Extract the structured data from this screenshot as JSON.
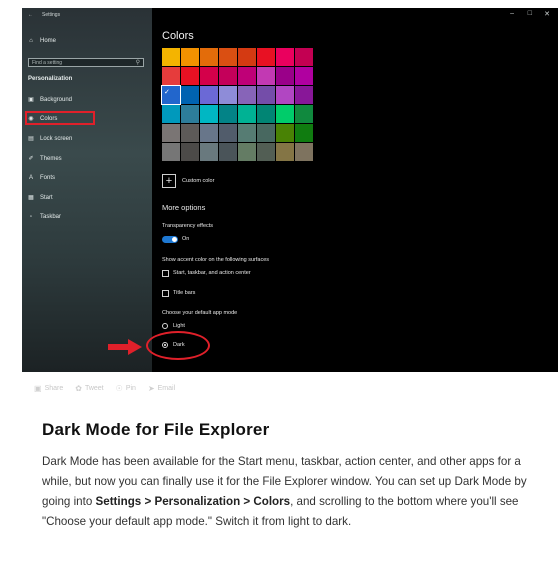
{
  "window": {
    "title": "Settings",
    "controls": [
      "–",
      "□",
      "✕"
    ]
  },
  "sidebar": {
    "home": "Home",
    "search_placeholder": "Find a setting",
    "section_title": "Personalization",
    "items": [
      {
        "label": "Background",
        "icon": "image-icon"
      },
      {
        "label": "Colors",
        "icon": "palette-icon"
      },
      {
        "label": "Lock screen",
        "icon": "lock-screen-icon"
      },
      {
        "label": "Themes",
        "icon": "brush-icon"
      },
      {
        "label": "Fonts",
        "icon": "font-icon"
      },
      {
        "label": "Start",
        "icon": "start-icon"
      },
      {
        "label": "Taskbar",
        "icon": "taskbar-icon"
      }
    ]
  },
  "main": {
    "title": "Colors",
    "swatches": [
      [
        "#f4b400",
        "#f39200",
        "#e36c0a",
        "#da4f12",
        "#d43a12",
        "#e81123",
        "#ea005e",
        "#c30052"
      ],
      [
        "#e63c3c",
        "#e81123",
        "#d4004a",
        "#c4005a",
        "#bf0077",
        "#c239b3",
        "#9a0089",
        "#b000a0"
      ],
      [
        "#2266cc",
        "#0063b1",
        "#6b69d6",
        "#8e8cd8",
        "#8764b8",
        "#744da9",
        "#b146c2",
        "#881798"
      ],
      [
        "#0099bc",
        "#2d7d9a",
        "#00b7c3",
        "#038387",
        "#00b294",
        "#018574",
        "#00cc6a",
        "#10893e"
      ],
      [
        "#7a7574",
        "#5d5a58",
        "#68768a",
        "#515c6b",
        "#567c73",
        "#486860",
        "#498205",
        "#107c10"
      ],
      [
        "#767676",
        "#4c4a48",
        "#69797e",
        "#4a5459",
        "#647c64",
        "#525e54",
        "#847545",
        "#7e735f"
      ]
    ],
    "selected_swatch": "2-0",
    "custom_color": "Custom color",
    "more_options": "More options",
    "transparency_label": "Transparency effects",
    "transparency_state": "On",
    "accent_surfaces_label": "Show accent color on the following surfaces",
    "accent_surface_1": "Start, taskbar, and action center",
    "accent_surface_2": "Title bars",
    "app_mode_label": "Choose your default app mode",
    "app_mode_light": "Light",
    "app_mode_dark": "Dark"
  },
  "share": {
    "share": "Share",
    "tweet": "Tweet",
    "pin": "Pin",
    "email": "Email"
  },
  "article": {
    "heading": "Dark Mode for File Explorer",
    "body_1": "Dark Mode has been available for the Start menu, taskbar, action center, and other apps for a while, but now you can finally use it for the File Explorer window. You can set up Dark Mode by going into ",
    "body_bold": "Settings > Personalization > Colors",
    "body_2": ", and scrolling to the bottom where you'll see \"Choose your default app mode.\" Switch it from light to dark."
  },
  "colors": {
    "highlight_red": "#e0202a",
    "toggle_blue": "#1e78d2"
  }
}
